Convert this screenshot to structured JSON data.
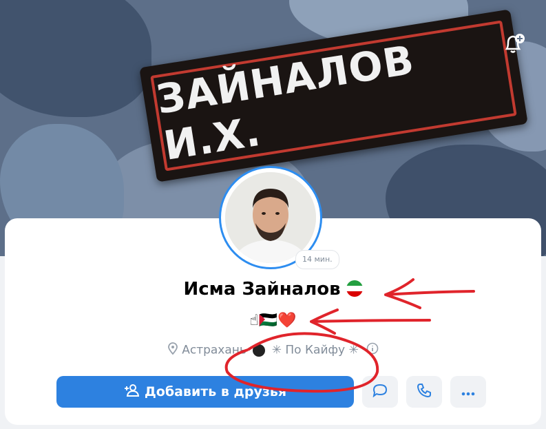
{
  "cover": {
    "patch_text": "ЗАЙНАЛОВ И.Х."
  },
  "profile": {
    "online_badge": "14 мин.",
    "name": "Исма Зайналов",
    "status_emoji": "☝🇵🇸❤️",
    "city": "Астрахань",
    "relation": "По Кайфу"
  },
  "actions": {
    "add_friend_label": "Добавить в друзья"
  },
  "colors": {
    "accent": "#2d81e0",
    "annotation": "#e0242b"
  },
  "icons": [
    "bell-plus-icon",
    "location-icon",
    "info-icon",
    "add-user-icon",
    "message-icon",
    "phone-icon",
    "more-icon"
  ]
}
